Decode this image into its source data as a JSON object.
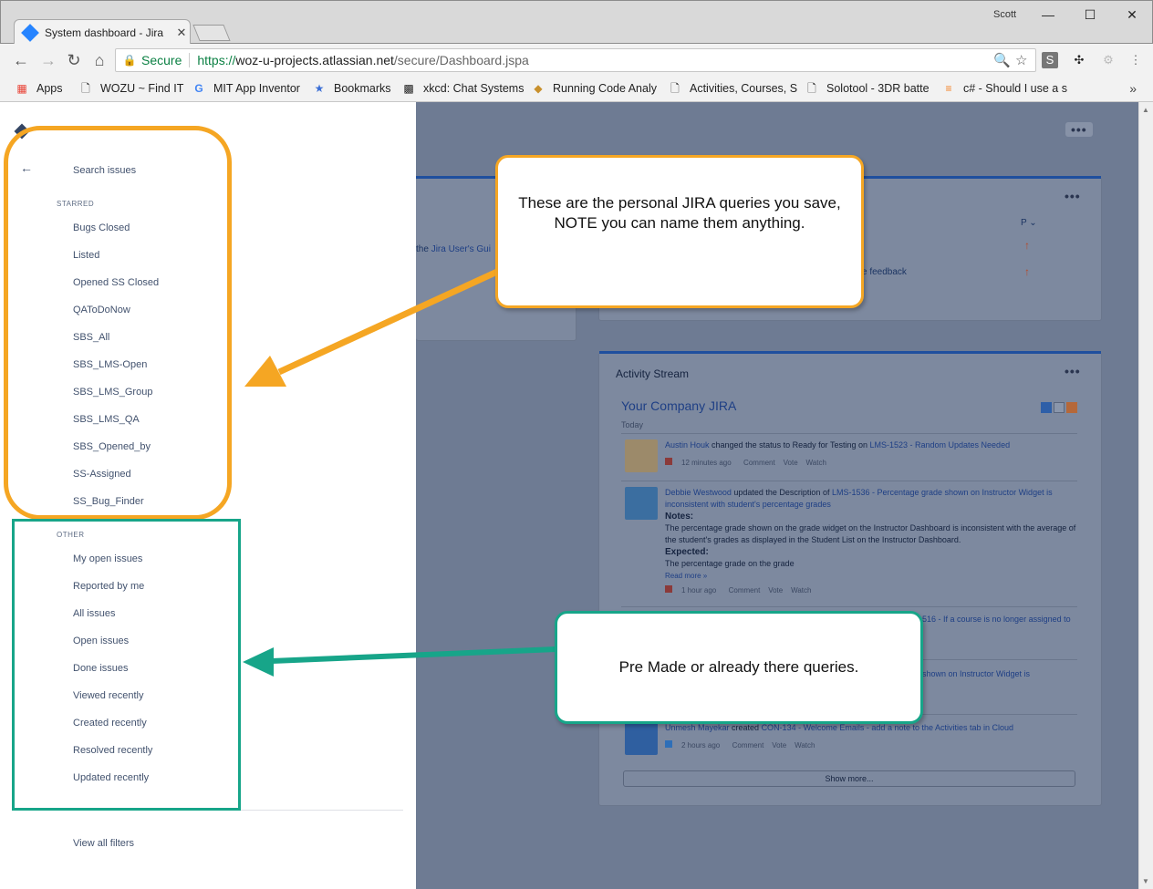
{
  "browser": {
    "tab_title": "System dashboard - Jira",
    "user_name": "Scott",
    "secure_label": "Secure",
    "url_scheme": "https://",
    "url_host": "woz-u-projects.atlassian.net",
    "url_path": "/secure/Dashboard.jspa",
    "bookmarks": [
      {
        "label": "Apps",
        "icon": "apps-grid-icon"
      },
      {
        "label": "WOZU ~ Find IT",
        "icon": "page-icon"
      },
      {
        "label": "MIT App Inventor",
        "icon": "google-icon"
      },
      {
        "label": "Bookmarks",
        "icon": "star-icon"
      },
      {
        "label": "xkcd: Chat Systems",
        "icon": "xkcd-icon"
      },
      {
        "label": "Running Code Analy",
        "icon": "code-analysis-icon"
      },
      {
        "label": "Activities, Courses, S",
        "icon": "page-icon"
      },
      {
        "label": "Solotool - 3DR batte",
        "icon": "page-icon"
      },
      {
        "label": "c# - Should I use a s",
        "icon": "stackoverflow-icon"
      }
    ]
  },
  "sidebar": {
    "search_label": "Search issues",
    "starred_heading": "STARRED",
    "starred": [
      "Bugs Closed",
      "Listed",
      "Opened SS Closed",
      "QAToDoNow",
      "SBS_All",
      "SBS_LMS-Open",
      "SBS_LMS_Group",
      "SBS_LMS_QA",
      "SBS_Opened_by",
      "SS-Assigned",
      "SS_Bug_Finder"
    ],
    "other_heading": "OTHER",
    "other": [
      "My open issues",
      "Reported by me",
      "All issues",
      "Open issues",
      "Done issues",
      "Viewed recently",
      "Created recently",
      "Resolved recently",
      "Updated recently"
    ],
    "view_all": "View all filters"
  },
  "background": {
    "intro_link_prefix": "the",
    "intro_link": "Jira User's Gui",
    "priority_header": "P",
    "feedback_fragment": "e feedback",
    "activity_title": "Activity Stream",
    "company": "Your Company JIRA",
    "today": "Today",
    "entries": [
      {
        "user": "Austin Houk",
        "action": " changed the status to Ready for Testing on ",
        "issue": "LMS-1523 - Random Updates Needed",
        "time": "12 minutes ago"
      },
      {
        "user": "Debbie Westwood",
        "action": " updated the Description of ",
        "issue": "LMS-1536 - Percentage grade shown on Instructor Widget is inconsistent with student's percentage grades",
        "notes_label": "Notes:",
        "notes": "The percentage grade shown on the grade widget on the Instructor Dashboard is inconsistent with the average of the student's grades as displayed in the Student List on the Instructor Dashboard.",
        "expected_label": "Expected:",
        "expected": "The percentage grade on the grade",
        "read_more": "Read more »",
        "time": "1 hour ago"
      },
      {
        "fragment": "516 - If a course is no longer assigned to"
      },
      {
        "fragment": "shown on Instructor Widget is"
      },
      {
        "user": "Unmesh Mayekar",
        "action": " created ",
        "issue": "CON-134 - Welcome Emails - add a note to the Activities tab in Cloud",
        "time": "2 hours ago"
      }
    ],
    "comment_label": "Comment",
    "vote_label": "Vote",
    "watch_label": "Watch",
    "show_more": "Show more..."
  },
  "annotations": {
    "orange_callout": "These are the personal JIRA queries you save, NOTE you can name them anything.",
    "teal_callout": "Pre Made or already there queries.",
    "orange_color": "#f5a623",
    "teal_color": "#17a589"
  }
}
